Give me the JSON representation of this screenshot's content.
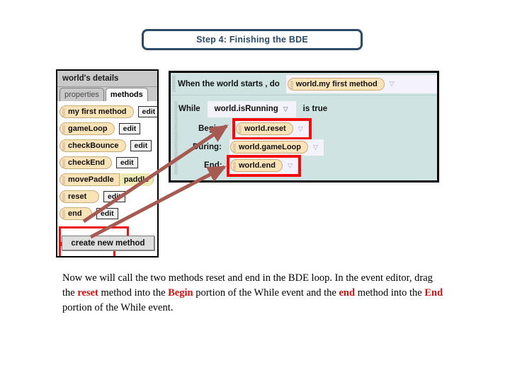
{
  "title": {
    "text": "Step 4: Finishing the BDE",
    "border_color": "#2c4a68",
    "text_color": "#2c4a68"
  },
  "details_panel": {
    "header": "world's details",
    "tabs": [
      {
        "label": "properties",
        "active": false
      },
      {
        "label": "methods",
        "active": true
      }
    ],
    "methods": [
      {
        "name": "my first method",
        "param": "",
        "edit": "edit",
        "highlight": false
      },
      {
        "name": "gameLoop",
        "param": "",
        "edit": "edit",
        "highlight": false
      },
      {
        "name": "checkBounce",
        "param": "",
        "edit": "edit",
        "highlight": false
      },
      {
        "name": "checkEnd",
        "param": "",
        "edit": "edit",
        "highlight": false
      },
      {
        "name": "movePaddle",
        "param": "paddle",
        "edit": "",
        "highlight": false
      },
      {
        "name": "reset",
        "param": "",
        "edit": "edit",
        "highlight": true
      },
      {
        "name": "end",
        "param": "",
        "edit": "edit",
        "highlight": true
      }
    ],
    "create_button": "create new method"
  },
  "event_editor": {
    "world_start": {
      "label": "When the world starts ,  do",
      "value": "world.my first method",
      "chevron": "chevron-down-icon"
    },
    "while_event": {
      "while_label": "While",
      "condition": "world.isRunning",
      "is_true_label": "is true",
      "rows": [
        {
          "label": "Begin:",
          "value": "world.reset",
          "highlight": true
        },
        {
          "label": "During:",
          "value": "world.gameLoop",
          "highlight": false
        },
        {
          "label": "End:",
          "value": "world.end",
          "highlight": true
        }
      ]
    },
    "panel_bg": "#cfe3e3",
    "highlight_color": "#f20c0c"
  },
  "caption": {
    "part1": "Now we will call the two methods reset and end in the BDE loop. In the event editor, drag the ",
    "hl1": "reset",
    "part2": " method into the ",
    "hl2": "Begin",
    "part3": " portion of the While event and the ",
    "hl3": "end",
    "part4": " method into the ",
    "hl4": "End",
    "part5": " portion of the While event."
  },
  "arrows": {
    "color": "#a65a52",
    "items": [
      {
        "name": "arrow-reset-to-begin",
        "from": "reset method tile",
        "to": "Begin slot"
      },
      {
        "name": "arrow-end-to-end-slot",
        "from": "end method tile",
        "to": "End slot"
      }
    ]
  }
}
